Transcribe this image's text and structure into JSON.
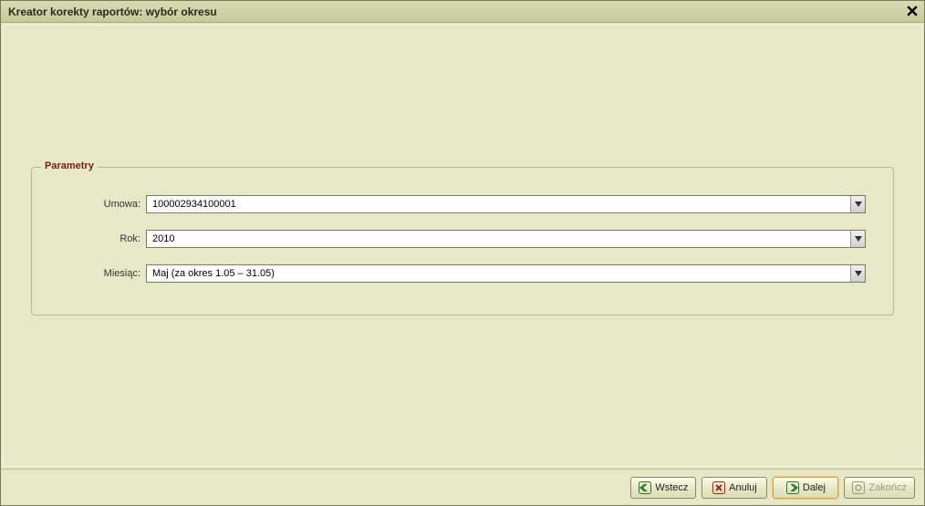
{
  "window": {
    "title": "Kreator korekty raportów: wybór okresu"
  },
  "fieldset": {
    "legend": "Parametry"
  },
  "form": {
    "umowa": {
      "label": "Umowa:",
      "value": "100002934100001"
    },
    "rok": {
      "label": "Rok:",
      "value": "2010"
    },
    "miesiac": {
      "label": "Miesiąc:",
      "value": "Maj (za okres 1.05 – 31.05)"
    }
  },
  "buttons": {
    "wstecz": "Wstecz",
    "anuluj": "Anuluj",
    "dalej": "Dalej",
    "zakoncz": "Zakończ"
  }
}
